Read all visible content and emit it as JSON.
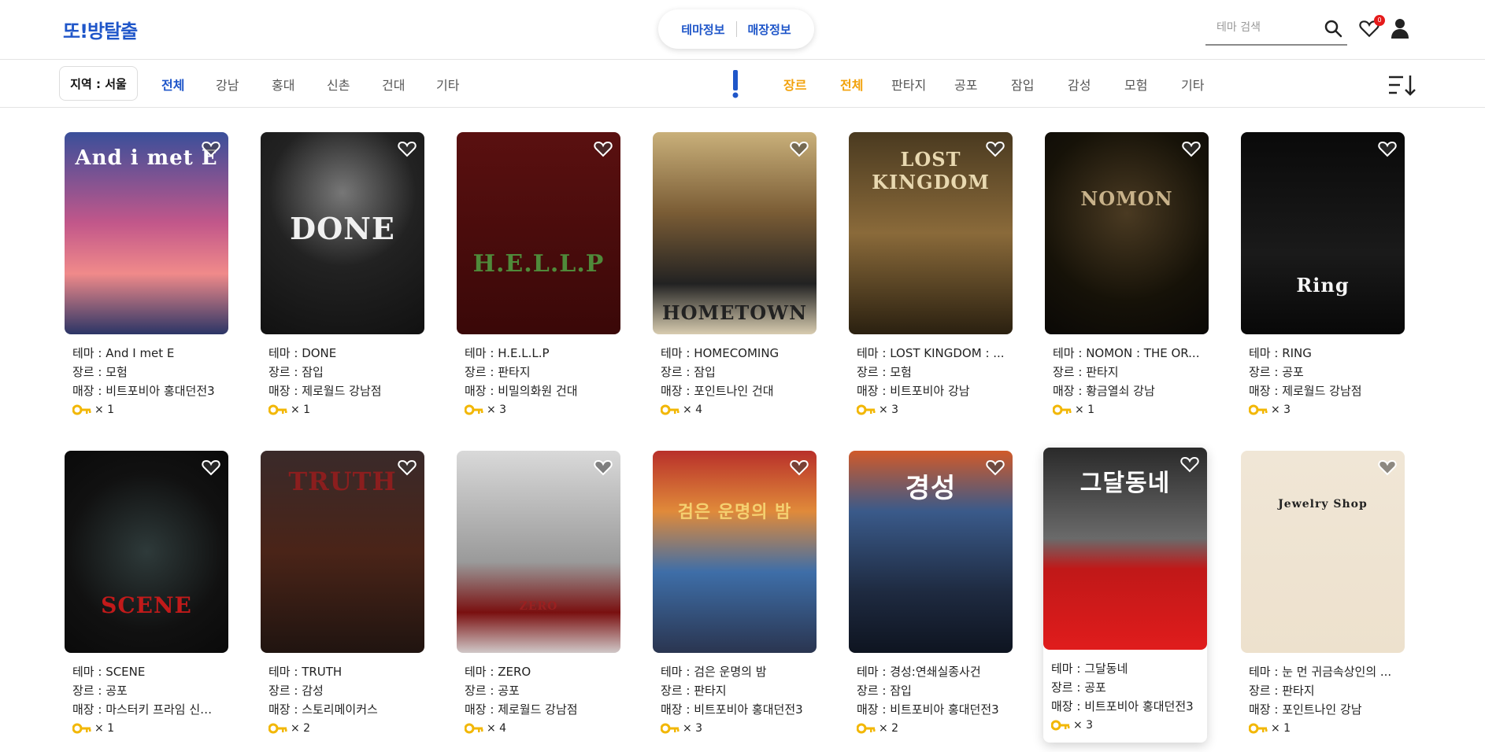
{
  "header": {
    "logo": "또!방탈출",
    "nav": [
      "테마정보",
      "매장정보"
    ],
    "search_placeholder": "테마 검색",
    "wishlist_count": "0"
  },
  "filters": {
    "region_button": "지역 : 서울",
    "regions": [
      "전체",
      "강남",
      "홍대",
      "신촌",
      "건대",
      "기타"
    ],
    "genre_label": "장르",
    "genres": [
      "전체",
      "판타지",
      "공포",
      "잠입",
      "감성",
      "모험",
      "기타"
    ]
  },
  "colors": {
    "brand": "#1f56c9",
    "genre_accent": "#f2a20c",
    "key": "#f2b705"
  },
  "cards": [
    {
      "theme": "테마 : And I met E",
      "genre": "장르 : 모험",
      "store": "매장 : 비트포비아 홍대던전3",
      "level": "× 1",
      "poster_text": "And i met E"
    },
    {
      "theme": "테마 : DONE",
      "genre": "장르 : 잠입",
      "store": "매장 : 제로월드 강남점",
      "level": "× 1",
      "poster_text": "DONE"
    },
    {
      "theme": "테마 : H.E.L.L.P",
      "genre": "장르 : 판타지",
      "store": "매장 : 비밀의화원 건대",
      "level": "× 3",
      "poster_text": "H.E.L.L.P"
    },
    {
      "theme": "테마 : HOMECOMING",
      "genre": "장르 : 잠입",
      "store": "매장 : 포인트나인 건대",
      "level": "× 4",
      "poster_text": "HOMETOWN"
    },
    {
      "theme": "테마 : LOST KINGDOM : ...",
      "genre": "장르 : 모험",
      "store": "매장 : 비트포비아 강남",
      "level": "× 3",
      "poster_text": "LOST KINGDOM"
    },
    {
      "theme": "테마 : NOMON : THE OR...",
      "genre": "장르 : 판타지",
      "store": "매장 : 황금열쇠 강남",
      "level": "× 1",
      "poster_text": "NOMON"
    },
    {
      "theme": "테마 : RING",
      "genre": "장르 : 공포",
      "store": "매장 : 제로월드 강남점",
      "level": "× 3",
      "poster_text": "Ring"
    },
    {
      "theme": "테마 : SCENE",
      "genre": "장르 : 공포",
      "store": "매장 : 마스터키 프라임 신촌...",
      "level": "× 1",
      "poster_text": "SCENE"
    },
    {
      "theme": "테마 : TRUTH",
      "genre": "장르 : 감성",
      "store": "매장 : 스토리메이커스",
      "level": "× 2",
      "poster_text": "TRUTH"
    },
    {
      "theme": "테마 : ZERO",
      "genre": "장르 : 공포",
      "store": "매장 : 제로월드 강남점",
      "level": "× 4",
      "poster_text": "ZERO"
    },
    {
      "theme": "테마 : 검은 운명의 밤",
      "genre": "장르 : 판타지",
      "store": "매장 : 비트포비아 홍대던전3",
      "level": "× 3",
      "poster_text": "검은 운명의 밤"
    },
    {
      "theme": "테마 : 경성:연쇄실종사건",
      "genre": "장르 : 잠입",
      "store": "매장 : 비트포비아 홍대던전3",
      "level": "× 2",
      "poster_text": "경성"
    },
    {
      "theme": "테마 : 그달동네",
      "genre": "장르 : 공포",
      "store": "매장 : 비트포비아 홍대던전3",
      "level": "× 3",
      "poster_text": "그달동네"
    },
    {
      "theme": "테마 : 눈 먼 귀금속상인의 ...",
      "genre": "장르 : 판타지",
      "store": "매장 : 포인트나인 강남",
      "level": "× 1",
      "poster_text": "Jewelry Shop"
    }
  ]
}
